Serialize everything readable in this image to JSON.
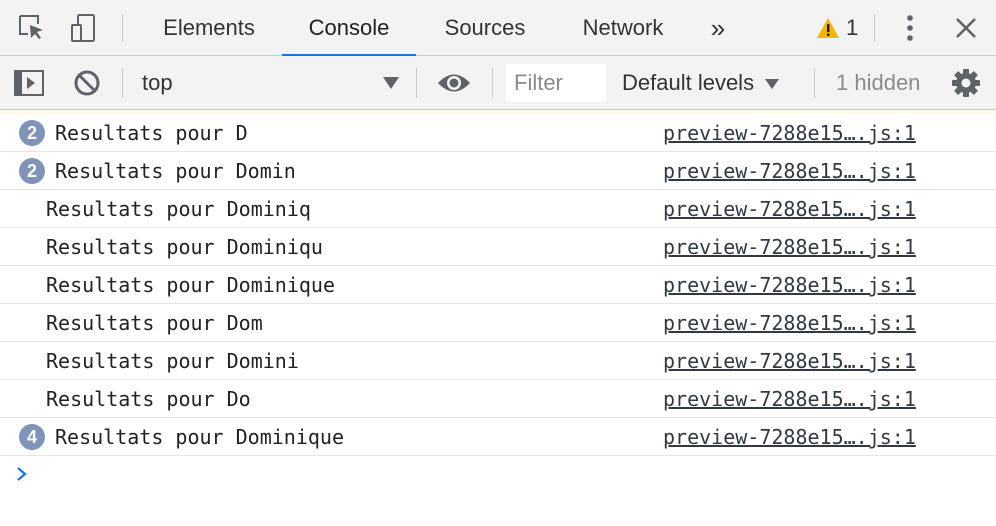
{
  "tabs": [
    {
      "label": "Elements"
    },
    {
      "label": "Console"
    },
    {
      "label": "Sources"
    },
    {
      "label": "Network"
    }
  ],
  "more_tabs_glyph": "»",
  "warnings": {
    "count": "1"
  },
  "toolbar": {
    "context": "top",
    "filter_placeholder": "Filter",
    "levels_label": "Default levels",
    "hidden_label": "1 hidden"
  },
  "colors": {
    "accent": "#1a73e8",
    "badge": "#8093b8",
    "warning": "#f4b400"
  },
  "messages": [
    {
      "count": "2",
      "text": "Resultats pour D",
      "source": "preview-7288e15….js:1"
    },
    {
      "count": "2",
      "text": "Resultats pour Domin",
      "source": "preview-7288e15….js:1"
    },
    {
      "count": "",
      "text": "Resultats pour Dominiq",
      "source": "preview-7288e15….js:1"
    },
    {
      "count": "",
      "text": "Resultats pour Dominiqu",
      "source": "preview-7288e15….js:1"
    },
    {
      "count": "",
      "text": "Resultats pour Dominique",
      "source": "preview-7288e15….js:1"
    },
    {
      "count": "",
      "text": "Resultats pour Dom",
      "source": "preview-7288e15….js:1"
    },
    {
      "count": "",
      "text": "Resultats pour Domini",
      "source": "preview-7288e15….js:1"
    },
    {
      "count": "",
      "text": "Resultats pour Do",
      "source": "preview-7288e15….js:1"
    },
    {
      "count": "4",
      "text": "Resultats pour Dominique",
      "source": "preview-7288e15….js:1"
    }
  ]
}
